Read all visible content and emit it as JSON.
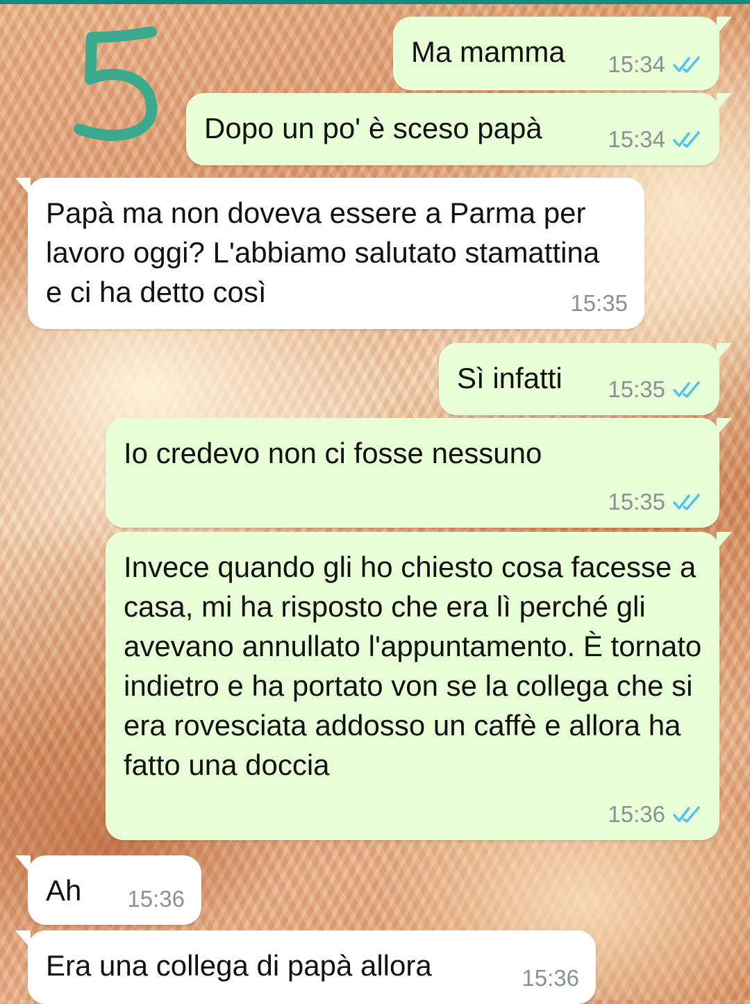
{
  "annotation": {
    "number": "5",
    "color": "#3aa98c"
  },
  "colors": {
    "outgoing_bubble": "#e7fed7",
    "incoming_bubble": "#ffffff",
    "read_ticks": "#4fc3f7",
    "timestamp": "#8b9094"
  },
  "messages": [
    {
      "direction": "outgoing",
      "text": "Ma mamma",
      "time": "15:34",
      "status": "read"
    },
    {
      "direction": "outgoing",
      "text": "Dopo un po' è sceso papà",
      "time": "15:34",
      "status": "read"
    },
    {
      "direction": "incoming",
      "text": "Papà ma non doveva essere a Parma per lavoro oggi? L'abbiamo salutato stamattina e ci ha detto così",
      "time": "15:35"
    },
    {
      "direction": "outgoing",
      "text": "Sì infatti",
      "time": "15:35",
      "status": "read"
    },
    {
      "direction": "outgoing",
      "text": "Io credevo non ci fosse nessuno",
      "time": "15:35",
      "status": "read"
    },
    {
      "direction": "outgoing",
      "text": "Invece quando gli ho chiesto cosa facesse a casa, mi ha risposto che era lì perché gli avevano annullato l'appuntamento. È tornato indietro e ha portato von se la collega che si era rovesciata addosso un caffè e allora ha fatto una doccia",
      "time": "15:36",
      "status": "read"
    },
    {
      "direction": "incoming",
      "text": "Ah",
      "time": "15:36"
    },
    {
      "direction": "incoming",
      "text": "Era una collega di papà allora",
      "time": "15:36"
    }
  ]
}
